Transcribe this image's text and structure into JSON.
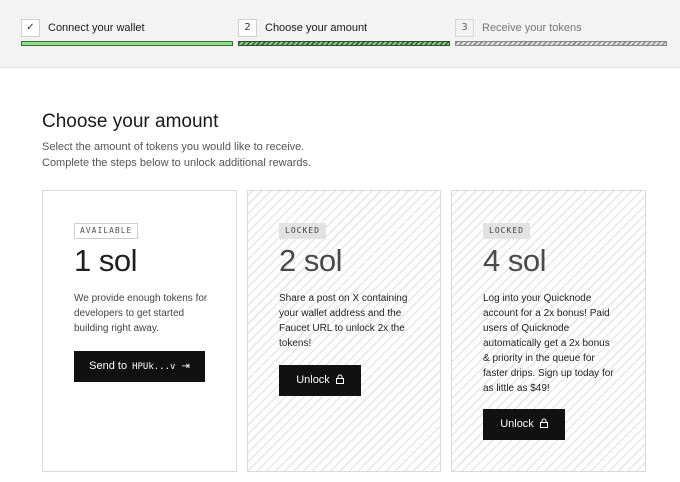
{
  "stepper": {
    "steps": [
      {
        "num": "✓",
        "label": "Connect your wallet"
      },
      {
        "num": "2",
        "label": "Choose your amount"
      },
      {
        "num": "3",
        "label": "Receive your tokens"
      }
    ]
  },
  "main": {
    "title": "Choose your amount",
    "subtitle_line1": "Select the amount of tokens you would like to receive.",
    "subtitle_line2": "Complete the steps below to unlock additional rewards."
  },
  "cards": [
    {
      "badge": "AVAILABLE",
      "amount": "1 sol",
      "desc": [
        "We provide enough tokens for",
        "developers to get started",
        "building right away."
      ],
      "button_label": "Send to",
      "button_address": "HPUk...v",
      "button_icon": "⇥"
    },
    {
      "badge": "LOCKED",
      "amount": "2 sol",
      "desc": [
        "Share a post on X containing",
        "your wallet address and the",
        "Faucet URL to unlock 2x the",
        "tokens!"
      ],
      "button_label": "Unlock"
    },
    {
      "badge": "LOCKED",
      "amount": "4 sol",
      "desc": [
        "Log into your Quicknode",
        "account for a 2x bonus! Paid",
        "users of Quicknode",
        "automatically get a 2x bonus",
        "& priority in the queue for",
        "faster drips. Sign up today for",
        "as little as $49!"
      ],
      "button_label": "Unlock"
    }
  ],
  "colors": {
    "step_done": "#8ee08a",
    "button": "#111111"
  }
}
